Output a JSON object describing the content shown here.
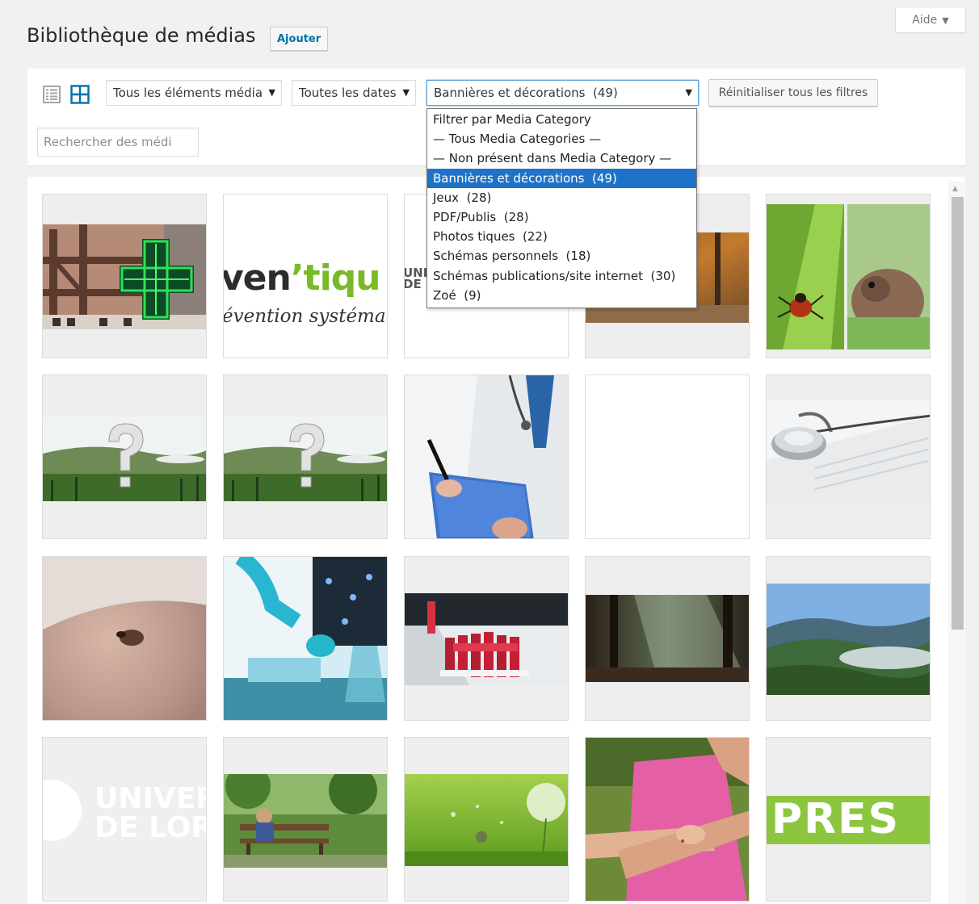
{
  "help": {
    "label": "Aide",
    "caret": "▼"
  },
  "header": {
    "title": "Bibliothèque de médias",
    "add_label": "Ajouter"
  },
  "toolbar": {
    "type_filter": "Tous les éléments média",
    "date_filter": "Toutes les dates",
    "category_filter": "Bannières et décorations  (49)",
    "select_arrow": "▼",
    "reset_label": "Réinitialiser tous les filtres",
    "search_placeholder": "Rechercher des médi"
  },
  "dropdown": {
    "options": [
      "Filtrer par Media Category",
      "— Tous Media Categories —",
      "— Non présent dans Media Category —",
      "Bannières et décorations  (49)",
      "Jeux  (28)",
      "PDF/Publis  (28)",
      "Photos tiques  (22)",
      "Schémas personnels  (18)",
      "Schémas publications/site internet  (30)",
      "Zoé  (9)"
    ],
    "selected_index": 3
  },
  "thumb_text": {
    "ventiques_a": "ven",
    "ventiques_b": "’tiqu",
    "ventiques_sub": "évention systémat",
    "univ_small_1": "UNI",
    "univ_small_2": "DE L",
    "univ_big_1": "UNIVERS",
    "univ_big_2": "DE LORR",
    "press": "PRES"
  },
  "scrollbar": {
    "up_arrow": "▲"
  }
}
